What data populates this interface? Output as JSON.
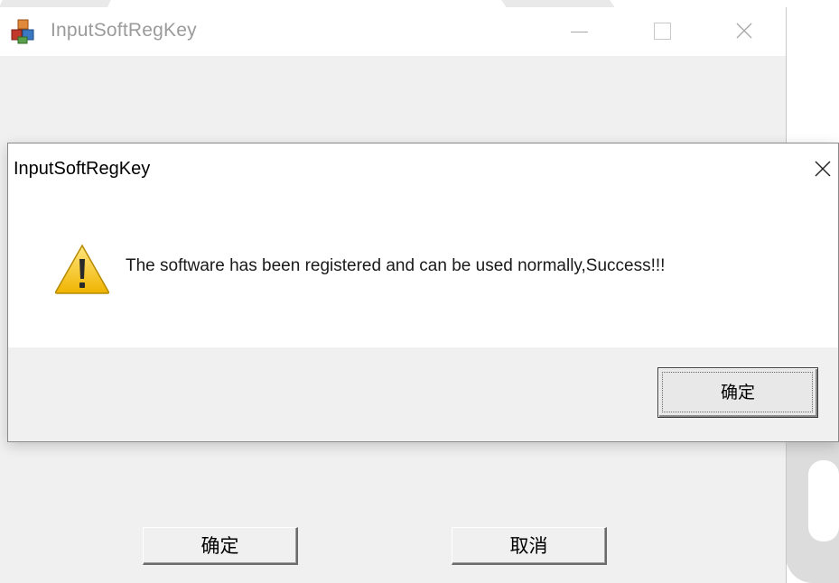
{
  "main_window": {
    "title": "InputSoftRegKey",
    "icon": "app-cubes-icon",
    "buttons": {
      "ok_label": "确定",
      "cancel_label": "取消"
    }
  },
  "dialog": {
    "title": "InputSoftRegKey",
    "icon": "warning-icon",
    "message": "The software has been registered and can be used normally,Success!!!",
    "ok_label": "确定"
  },
  "colors": {
    "dialog_footer": "#f0f0f0",
    "warning_yellow": "#f5c518",
    "title_gray": "#9b9b9b"
  }
}
